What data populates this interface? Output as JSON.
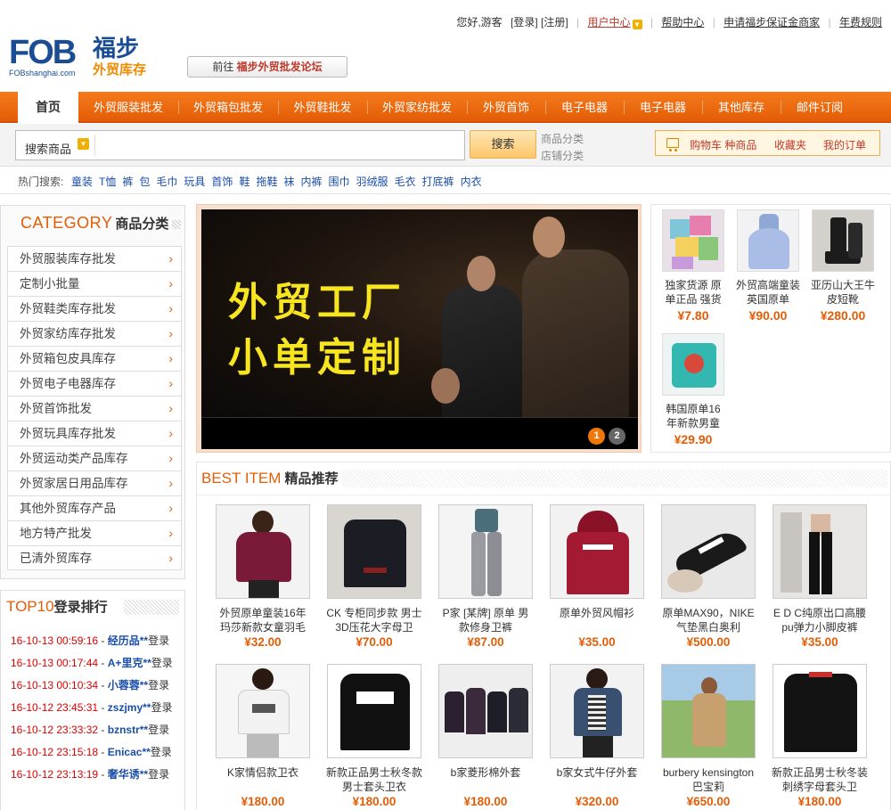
{
  "logo": {
    "letters": "FOB",
    "domain": "FOBshanghai.com",
    "cn_name": "福步",
    "cn_sub": "外贸库存"
  },
  "forum": {
    "prefix": "前往",
    "link": "福步外贸批发论坛"
  },
  "toplinks": {
    "greeting": "您好,游客",
    "login": "[登录]",
    "register": "[注册]",
    "user_center": "用户中心",
    "help": "帮助中心",
    "apply": "申请福步保证金商家",
    "fee": "年费规则"
  },
  "nav": {
    "home": "首页",
    "items": [
      "外贸服装批发",
      "外贸箱包批发",
      "外贸鞋批发",
      "外贸家纺批发",
      "外贸首饰",
      "电子电器",
      "电子电器",
      "其他库存",
      "邮件订阅"
    ]
  },
  "search": {
    "label": "搜索商品",
    "placeholder": "",
    "button": "搜索",
    "types": [
      "商品分类",
      "店铺分类"
    ]
  },
  "cart": {
    "cart_label": "购物车 种商品",
    "favorites": "收藏夹",
    "orders": "我的订单"
  },
  "hot": {
    "label": "热门搜索:",
    "items": [
      "童装",
      "T恤",
      "裤",
      "包",
      "毛巾",
      "玩具",
      "首饰",
      "鞋",
      "拖鞋",
      "袜",
      "内裤",
      "围巾",
      "羽绒服",
      "毛衣",
      "打底裤",
      "内衣"
    ]
  },
  "category": {
    "title_en": "CATEGORY",
    "title_cn": "商品分类",
    "items": [
      "外贸服装库存批发",
      "定制小批量",
      "外贸鞋类库存批发",
      "外贸家纺库存批发",
      "外贸箱包皮具库存",
      "外贸电子电器库存",
      "外贸首饰批发",
      "外贸玩具库存批发",
      "外贸运动类产品库存",
      "外贸家居日用品库存",
      "其他外贸库存产品",
      "地方特产批发",
      "已清外贸库存"
    ]
  },
  "top10": {
    "title_en": "TOP10",
    "title_cn": "登录排行",
    "suffix": "登录",
    "rows": [
      {
        "time": "16-10-13 00:59:16",
        "name": "经历品**"
      },
      {
        "time": "16-10-13 00:17:44",
        "name": "A+里克**"
      },
      {
        "time": "16-10-13 00:10:34",
        "name": "小蓉蓉**"
      },
      {
        "time": "16-10-12 23:45:31",
        "name": "zszjmy**"
      },
      {
        "time": "16-10-12 23:33:32",
        "name": "bznstr**"
      },
      {
        "time": "16-10-12 23:15:18",
        "name": "Enicac**"
      },
      {
        "time": "16-10-12 23:13:19",
        "name": "奢华诱**"
      }
    ]
  },
  "banner": {
    "line1": "外贸工厂",
    "line2": "小单定制",
    "dots": [
      "1",
      "2"
    ]
  },
  "mini_products": [
    {
      "name": "独家货源 原单正品 强货",
      "price": "¥7.80"
    },
    {
      "name": "外贸高端童装英国原单",
      "price": "¥90.00"
    },
    {
      "name": "亚历山大王牛皮短靴",
      "price": "¥280.00"
    },
    {
      "name": "韩国原单16年新款男童",
      "price": "¥29.90"
    }
  ],
  "best": {
    "title_en": "BEST ITEM",
    "title_cn": "精品推荐",
    "items": [
      {
        "name": "外贸原单童装16年玛莎新款女童羽毛",
        "price": "¥32.00"
      },
      {
        "name": "CK 专柜同步款 男士3D压花大字母卫",
        "price": "¥70.00"
      },
      {
        "name": "P家 [某牌] 原单 男款修身卫裤",
        "price": "¥87.00"
      },
      {
        "name": "原单外贸风帽衫",
        "price": "¥35.00"
      },
      {
        "name": "原单MAX90，NIKE气垫黑白奥利",
        "price": "¥500.00"
      },
      {
        "name": "E D C纯原出口高腰pu弹力小脚皮裤",
        "price": "¥35.00"
      },
      {
        "name": "K家情侣款卫衣",
        "price": "¥180.00"
      },
      {
        "name": "新款正品男士秋冬款男士套头卫衣",
        "price": "¥180.00"
      },
      {
        "name": "b家菱形棉外套",
        "price": "¥180.00"
      },
      {
        "name": "b家女式牛仔外套",
        "price": "¥320.00"
      },
      {
        "name": "burbery kensington巴宝莉",
        "price": "¥650.00"
      },
      {
        "name": "新款正品男士秋冬装刺绣字母套头卫",
        "price": "¥180.00"
      }
    ]
  },
  "colors": {
    "accent": "#e35d07",
    "nav": "#f57a1c",
    "link": "#1a4ea8",
    "price": "#e35d07",
    "banner_text": "#f7e61f"
  }
}
